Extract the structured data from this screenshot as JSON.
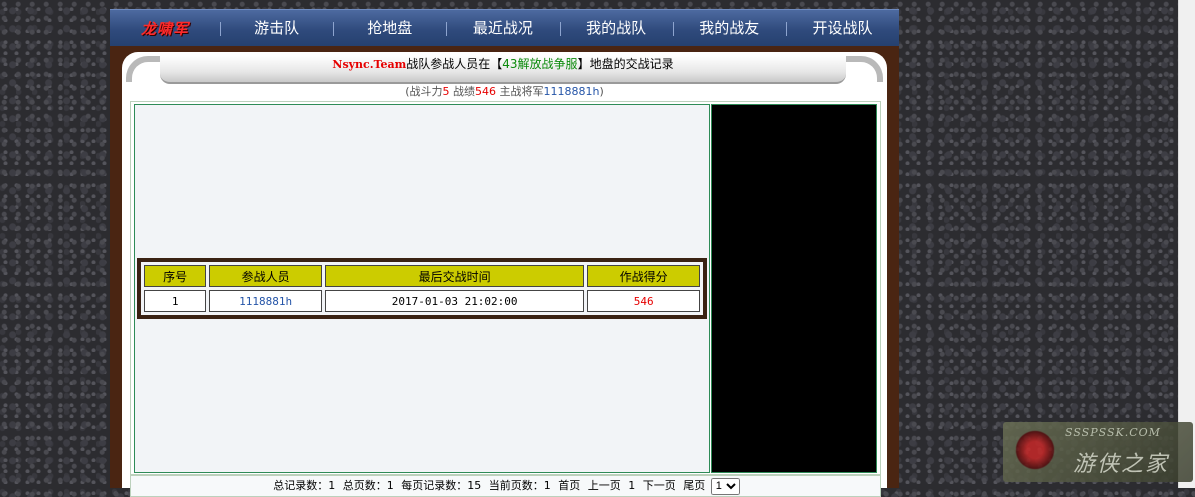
{
  "nav": {
    "logo": "龙啸军",
    "items": [
      "游击队",
      "抢地盘",
      "最近战况",
      "我的战队",
      "我的战友",
      "开设战队"
    ]
  },
  "header": {
    "team": "Nsync.Team",
    "text1": "战队参战人员在【",
    "server": "43解放战争服",
    "text2": "】地盘的交战记录"
  },
  "stats": {
    "power_label": "(战斗力",
    "power": "5",
    "record_label": " 战绩",
    "record": "546",
    "general_label": " 主战将军",
    "general": "1118881h",
    "close": ")"
  },
  "table": {
    "headers": [
      "序号",
      "参战人员",
      "最后交战时间",
      "作战得分"
    ],
    "rows": [
      {
        "no": "1",
        "member": "1118881h",
        "time": "2017-01-03 21:02:00",
        "score": "546"
      }
    ]
  },
  "pager": {
    "total_label": "总记录数：1",
    "pages_label": "总页数：1",
    "per_page_label": "每页记录数：15",
    "current_label": "当前页数：1",
    "first": "首页",
    "prev": "上一页",
    "page_num": "1",
    "next": "下一页",
    "last": "尾页",
    "select_value": "1"
  },
  "watermark": {
    "top": "SSSPSSK.COM",
    "main": "游侠之家"
  },
  "colors": {
    "nav_bg": "#2f4a7c",
    "frame": "#4a2512",
    "header_yellow": "#cccc00",
    "accent_red": "#e60000",
    "accent_blue": "#2555a8",
    "accent_green": "#0a8a0a"
  }
}
